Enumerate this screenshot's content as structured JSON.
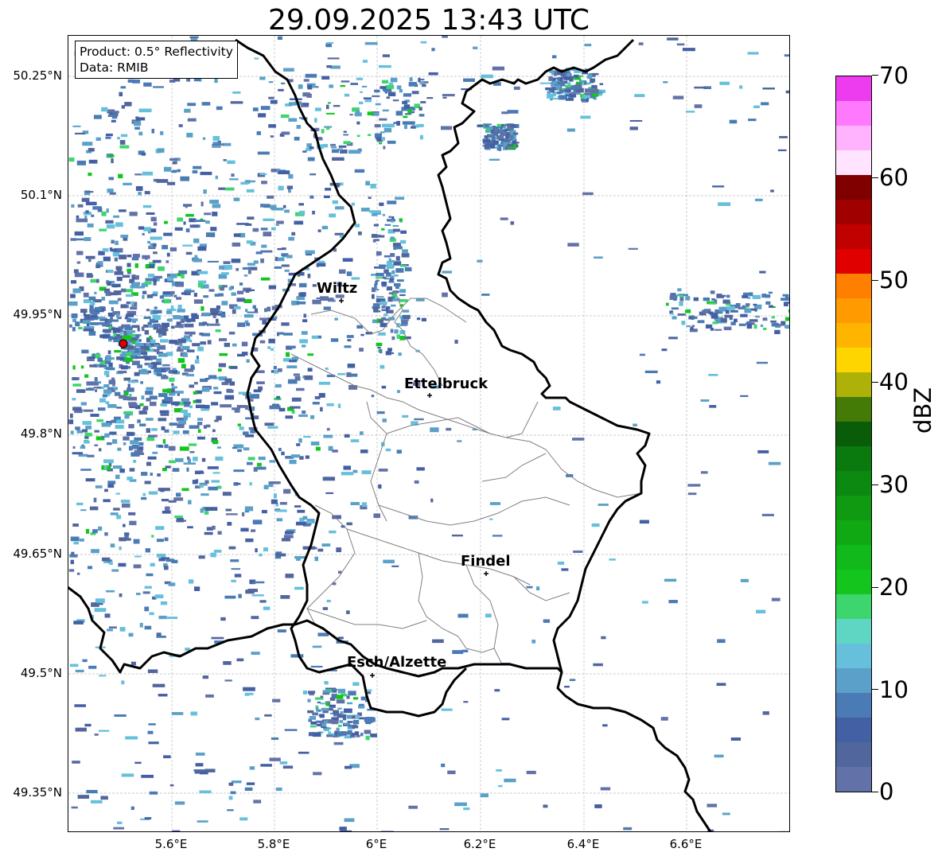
{
  "title": "29.09.2025 13:43 UTC",
  "info_box": {
    "product": "Product: 0.5° Reflectivity",
    "data_source": "Data: RMIB"
  },
  "map": {
    "latitude_ticks": [
      "50.25°N",
      "50.1°N",
      "49.95°N",
      "49.8°N",
      "49.65°N",
      "49.5°N",
      "49.35°N"
    ],
    "longitude_ticks": [
      "5.6°E",
      "5.8°E",
      "6°E",
      "6.2°E",
      "6.4°E",
      "6.6°E"
    ],
    "places": [
      {
        "name": "Wiltz"
      },
      {
        "name": "Ettelbruck"
      },
      {
        "name": "Findel"
      },
      {
        "name": "Esch/Alzette"
      }
    ],
    "radar_site_color": "#e30000",
    "border_color": "#000000",
    "district_color": "#808080"
  },
  "colorbar": {
    "unit": "dBZ",
    "range": [
      0,
      70
    ],
    "tick_labels": [
      "0",
      "10",
      "20",
      "30",
      "40",
      "50",
      "60",
      "70"
    ],
    "colors": [
      "#6272a8",
      "#52669e",
      "#4460a4",
      "#4a7bb4",
      "#5aa0c8",
      "#66c0dc",
      "#5fd6c4",
      "#3dd56d",
      "#13c51c",
      "#11b91b",
      "#10a914",
      "#0f9a12",
      "#0c8910",
      "#0b7a0e",
      "#095c08",
      "#437b06",
      "#aeb107",
      "#ffd500",
      "#ffb500",
      "#ff9b00",
      "#ff8000",
      "#e00000",
      "#c10000",
      "#a00000",
      "#800000",
      "#ffe3ff",
      "#ffb3ff",
      "#ff79ff",
      "#ed3cef"
    ]
  }
}
